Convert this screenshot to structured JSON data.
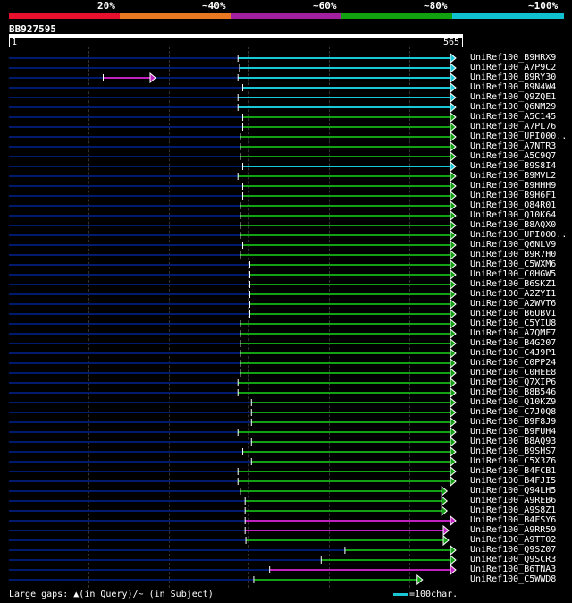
{
  "legend": {
    "segments": [
      {
        "label": "20%",
        "color": "#e8102c"
      },
      {
        "label": "~40%",
        "color": "#e87722"
      },
      {
        "label": "~60%",
        "color": "#a020a0"
      },
      {
        "label": "~80%",
        "color": "#10a010"
      },
      {
        "label": "~100%",
        "color": "#10c0d0"
      }
    ]
  },
  "query": {
    "id": "BB927595",
    "start": "1",
    "end": "565",
    "length": 565
  },
  "colors": {
    "cyan": "#19c6d6",
    "green": "#14a014",
    "magenta": "#c020c0",
    "navy": "#001a6e",
    "arrowhead_fill": "#ffffff"
  },
  "hits": [
    {
      "name": "UniRef100_B9HRX9",
      "start": 290,
      "end": 565,
      "color": "cyan"
    },
    {
      "name": "UniRef100_A7P9C2",
      "start": 292,
      "end": 565,
      "color": "cyan"
    },
    {
      "name": "UniRef100_B9RY30",
      "start": 290,
      "end": 565,
      "color": "cyan",
      "extra": {
        "start": 120,
        "end": 186,
        "color": "magenta"
      }
    },
    {
      "name": "UniRef100_B9N4W4",
      "start": 296,
      "end": 565,
      "color": "cyan"
    },
    {
      "name": "UniRef100_Q9ZQE1",
      "start": 290,
      "end": 565,
      "color": "cyan"
    },
    {
      "name": "UniRef100_Q6NM29",
      "start": 290,
      "end": 565,
      "color": "cyan"
    },
    {
      "name": "UniRef100_A5C145",
      "start": 296,
      "end": 565,
      "color": "green"
    },
    {
      "name": "UniRef100_A7PL76",
      "start": 296,
      "end": 565,
      "color": "green"
    },
    {
      "name": "UniRef100_UPI000..",
      "start": 293,
      "end": 565,
      "color": "green"
    },
    {
      "name": "UniRef100_A7NTR3",
      "start": 293,
      "end": 565,
      "color": "green"
    },
    {
      "name": "UniRef100_A5C9Q7",
      "start": 293,
      "end": 565,
      "color": "green"
    },
    {
      "name": "UniRef100_B9S8I4",
      "start": 296,
      "end": 565,
      "color": "cyan"
    },
    {
      "name": "UniRef100_B9MVL2",
      "start": 290,
      "end": 565,
      "color": "green"
    },
    {
      "name": "UniRef100_B9HHH9",
      "start": 296,
      "end": 565,
      "color": "green"
    },
    {
      "name": "UniRef100_B9H6F1",
      "start": 296,
      "end": 565,
      "color": "green"
    },
    {
      "name": "UniRef100_Q84R01",
      "start": 293,
      "end": 565,
      "color": "green"
    },
    {
      "name": "UniRef100_Q10K64",
      "start": 293,
      "end": 565,
      "color": "green"
    },
    {
      "name": "UniRef100_B8AQX0",
      "start": 293,
      "end": 565,
      "color": "green"
    },
    {
      "name": "UniRef100_UPI000..",
      "start": 293,
      "end": 565,
      "color": "green"
    },
    {
      "name": "UniRef100_Q6NLV9",
      "start": 296,
      "end": 565,
      "color": "green"
    },
    {
      "name": "UniRef100_B9R7H0",
      "start": 293,
      "end": 565,
      "color": "green"
    },
    {
      "name": "UniRef100_C5WXM6",
      "start": 305,
      "end": 565,
      "color": "green"
    },
    {
      "name": "UniRef100_C0HGW5",
      "start": 305,
      "end": 565,
      "color": "green"
    },
    {
      "name": "UniRef100_B6SKZ1",
      "start": 305,
      "end": 565,
      "color": "green"
    },
    {
      "name": "UniRef100_A2ZYI1",
      "start": 305,
      "end": 565,
      "color": "green"
    },
    {
      "name": "UniRef100_A2WVT6",
      "start": 305,
      "end": 565,
      "color": "green"
    },
    {
      "name": "UniRef100_B6UBV1",
      "start": 305,
      "end": 565,
      "color": "green"
    },
    {
      "name": "UniRef100_C5YIU8",
      "start": 293,
      "end": 565,
      "color": "green"
    },
    {
      "name": "UniRef100_A7QMF7",
      "start": 293,
      "end": 565,
      "color": "green"
    },
    {
      "name": "UniRef100_B4G207",
      "start": 293,
      "end": 565,
      "color": "green"
    },
    {
      "name": "UniRef100_C4J9P1",
      "start": 293,
      "end": 565,
      "color": "green"
    },
    {
      "name": "UniRef100_C0PP24",
      "start": 293,
      "end": 565,
      "color": "green"
    },
    {
      "name": "UniRef100_C0HEE8",
      "start": 293,
      "end": 565,
      "color": "green"
    },
    {
      "name": "UniRef100_Q7XIP6",
      "start": 290,
      "end": 565,
      "color": "green"
    },
    {
      "name": "UniRef100_B8B546",
      "start": 290,
      "end": 565,
      "color": "green"
    },
    {
      "name": "UniRef100_Q10KZ9",
      "start": 307,
      "end": 565,
      "color": "green"
    },
    {
      "name": "UniRef100_C7J0Q8",
      "start": 307,
      "end": 565,
      "color": "green"
    },
    {
      "name": "UniRef100_B9F8J9",
      "start": 307,
      "end": 565,
      "color": "green"
    },
    {
      "name": "UniRef100_B9FUH4",
      "start": 290,
      "end": 565,
      "color": "green"
    },
    {
      "name": "UniRef100_B8AQ93",
      "start": 307,
      "end": 565,
      "color": "green"
    },
    {
      "name": "UniRef100_B9SHS7",
      "start": 296,
      "end": 565,
      "color": "green"
    },
    {
      "name": "UniRef100_C5X3Z6",
      "start": 307,
      "end": 565,
      "color": "green"
    },
    {
      "name": "UniRef100_B4FCB1",
      "start": 290,
      "end": 565,
      "color": "green"
    },
    {
      "name": "UniRef100_B4FJI5",
      "start": 290,
      "end": 565,
      "color": "green"
    },
    {
      "name": "UniRef100_Q94LH5",
      "start": 293,
      "end": 554,
      "color": "green"
    },
    {
      "name": "UniRef100_A9REB6",
      "start": 299,
      "end": 554,
      "color": "green"
    },
    {
      "name": "UniRef100_A9S8Z1",
      "start": 299,
      "end": 554,
      "color": "green"
    },
    {
      "name": "UniRef100_B4FSY6",
      "start": 299,
      "end": 565,
      "color": "magenta"
    },
    {
      "name": "UniRef100_A9RR59",
      "start": 299,
      "end": 556,
      "color": "magenta"
    },
    {
      "name": "UniRef100_A9TT02",
      "start": 300,
      "end": 556,
      "color": "green"
    },
    {
      "name": "UniRef100_Q9SZ07",
      "start": 425,
      "end": 565,
      "color": "green"
    },
    {
      "name": "UniRef100_Q9SCR3",
      "start": 395,
      "end": 565,
      "color": "green"
    },
    {
      "name": "UniRef100_B6TNA3",
      "start": 330,
      "end": 565,
      "color": "magenta"
    },
    {
      "name": "UniRef100_C5WWD8",
      "start": 310,
      "end": 523,
      "color": "green"
    }
  ],
  "footer": {
    "gaps_label": "Large gaps:",
    "query_symbol": "▲",
    "query_text": "(in Query)/",
    "subject_symbol": "~",
    "subject_text": " (in Subject)",
    "scale_text": "=100char."
  }
}
